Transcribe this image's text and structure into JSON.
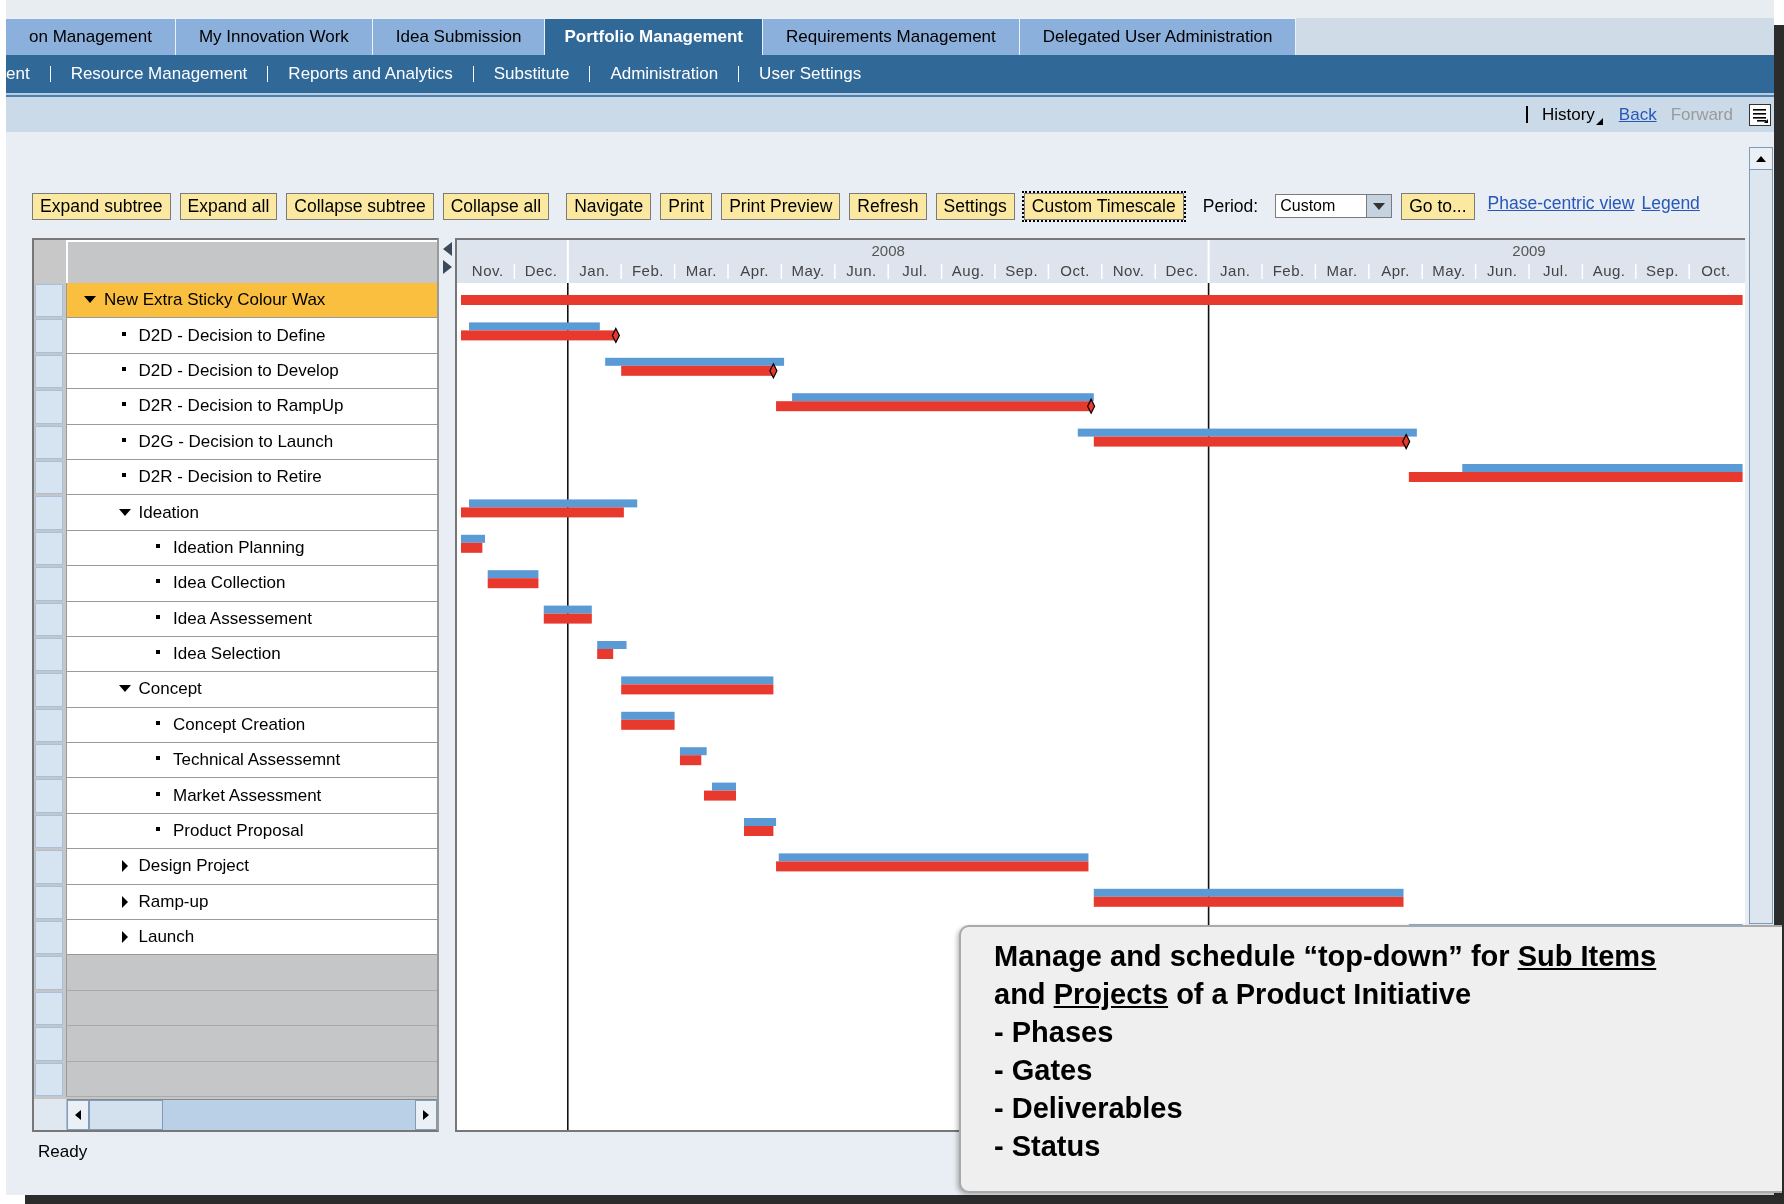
{
  "tabs": [
    {
      "label": "on Management",
      "selected": false
    },
    {
      "label": "My Innovation Work",
      "selected": false
    },
    {
      "label": "Idea Submission",
      "selected": false
    },
    {
      "label": "Portfolio Management",
      "selected": true
    },
    {
      "label": "Requirements Management",
      "selected": false
    },
    {
      "label": "Delegated User Administration",
      "selected": false
    }
  ],
  "subnav": [
    "ent",
    "Resource Management",
    "Reports and Analytics",
    "Substitute",
    "Administration",
    "User Settings"
  ],
  "history_bar": {
    "history": "History",
    "back": "Back",
    "forward": {
      "label": "Forward",
      "disabled": true
    }
  },
  "toolbar": {
    "buttons": [
      {
        "label": "Expand subtree",
        "focused": false
      },
      {
        "label": "Expand all",
        "focused": false
      },
      {
        "label": "Collapse subtree",
        "focused": false
      },
      {
        "label": "Collapse all",
        "focused": false
      },
      {
        "label": "Navigate",
        "focused": false
      },
      {
        "label": "Print",
        "focused": false
      },
      {
        "label": "Print Preview",
        "focused": false
      },
      {
        "label": "Refresh",
        "focused": false
      },
      {
        "label": "Settings",
        "focused": false
      },
      {
        "label": "Custom Timescale",
        "focused": true
      }
    ],
    "period_label": "Period:",
    "period": "Custom",
    "goto": "Go to...",
    "links": [
      "Phase-centric view",
      "Legend"
    ]
  },
  "gantt": {
    "tree": [
      {
        "label": "New Extra Sticky Colour Wax",
        "kind": "folder",
        "expanded": true,
        "selected": true,
        "children": [
          {
            "label": "D2D - Decision to Define",
            "kind": "leaf",
            "selected": false
          },
          {
            "label": "D2D - Decision to Develop",
            "kind": "leaf",
            "selected": false
          },
          {
            "label": "D2R - Decision to RampUp",
            "kind": "leaf",
            "selected": false
          },
          {
            "label": "D2G - Decision to Launch",
            "kind": "leaf",
            "selected": false
          },
          {
            "label": "D2R - Decision to Retire",
            "kind": "leaf",
            "selected": false
          },
          {
            "label": "Ideation",
            "kind": "folder",
            "expanded": true,
            "selected": false,
            "children": [
              {
                "label": "Ideation Planning",
                "kind": "leaf",
                "selected": false
              },
              {
                "label": "Idea Collection",
                "kind": "leaf",
                "selected": false
              },
              {
                "label": "Idea Assessement",
                "kind": "leaf",
                "selected": false
              },
              {
                "label": "Idea Selection",
                "kind": "leaf",
                "selected": false
              }
            ]
          },
          {
            "label": "Concept",
            "kind": "folder",
            "expanded": true,
            "selected": false,
            "children": [
              {
                "label": "Concept Creation",
                "kind": "leaf",
                "selected": false
              },
              {
                "label": "Technical Assessemnt",
                "kind": "leaf",
                "selected": false
              },
              {
                "label": "Market Assessment",
                "kind": "leaf",
                "selected": false
              },
              {
                "label": "Product Proposal",
                "kind": "leaf",
                "selected": false
              }
            ]
          },
          {
            "label": "Design Project",
            "kind": "folder",
            "expanded": false,
            "selected": false
          },
          {
            "label": "Ramp-up",
            "kind": "folder",
            "expanded": false,
            "selected": false
          },
          {
            "label": "Launch",
            "kind": "folder",
            "expanded": false,
            "selected": false
          }
        ]
      }
    ],
    "timeline": [
      {
        "months": [
          "Nov.",
          "Dec."
        ]
      },
      {
        "year": "2008",
        "months": [
          "Jan.",
          "Feb.",
          "Mar.",
          "Apr.",
          "May.",
          "Jun.",
          "Jul.",
          "Aug.",
          "Sep.",
          "Oct.",
          "Nov.",
          "Dec."
        ]
      },
      {
        "year": "2009",
        "months": [
          "Jan.",
          "Feb.",
          "Mar.",
          "Apr.",
          "May.",
          "Jun.",
          "Jul.",
          "Aug.",
          "Sep.",
          "Oct."
        ]
      }
    ]
  },
  "status": "Ready",
  "callout": {
    "heading": [
      {
        "text": "Manage and schedule “top-down” for ",
        "underline": false
      },
      {
        "text": "Sub Items",
        "underline": true
      },
      {
        "text": " and ",
        "underline": false
      },
      {
        "text": "Projects",
        "underline": true
      },
      {
        "text": " of a Product Initiative",
        "underline": false
      }
    ],
    "points": [
      "- Phases",
      "- Gates",
      "- Deliverables",
      "- Status"
    ]
  }
}
